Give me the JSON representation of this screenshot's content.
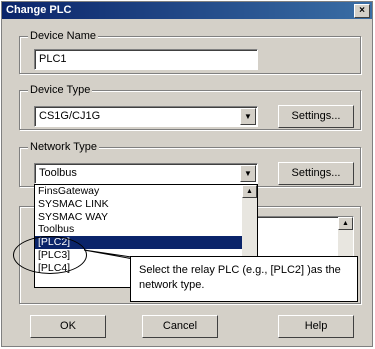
{
  "window": {
    "title": "Change PLC",
    "close_symbol": "×"
  },
  "device_name": {
    "label": "Device Name",
    "value": "PLC1"
  },
  "device_type": {
    "label": "Device Type",
    "value": "CS1G/CJ1G",
    "settings_label": "Settings..."
  },
  "network_type": {
    "label": "Network Type",
    "value": "Toolbus",
    "settings_label": "Settings...",
    "dropdown_items": [
      "FinsGateway",
      "SYSMAC LINK",
      "SYSMAC WAY",
      "Toolbus",
      "[PLC2]",
      "[PLC3]",
      "[PLC4]"
    ],
    "selected_index": 4
  },
  "callout": {
    "text": "Select the relay PLC (e.g., [PLC2] )as the network type."
  },
  "footer": {
    "ok_label": "OK",
    "cancel_label": "Cancel",
    "help_label": "Help"
  },
  "icons": {
    "dropdown_arrow": "▼",
    "scroll_up": "▲"
  }
}
